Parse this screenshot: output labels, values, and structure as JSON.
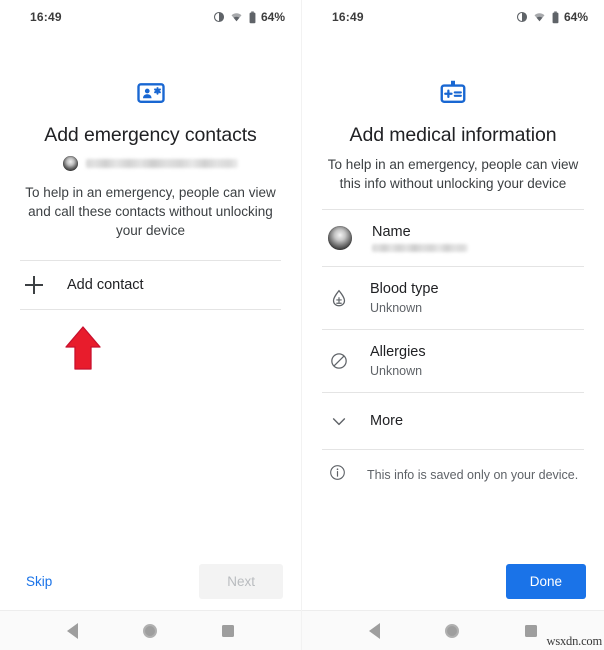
{
  "status_bar": {
    "time": "16:49",
    "battery_percent": "64%",
    "icons": [
      "dnd-icon",
      "wifi-icon",
      "battery-icon"
    ]
  },
  "left_screen": {
    "hero_icon": "emergency-contact-card-icon",
    "title": "Add emergency contacts",
    "account": {
      "avatar": "account-avatar",
      "email_redacted": true
    },
    "description": "To help in an emergency, people can view and call these contacts without unlocking your device",
    "add_contact": {
      "icon": "plus-icon",
      "label": "Add contact"
    },
    "annotation": {
      "type": "arrow-up",
      "color": "#e81c2c"
    },
    "footer": {
      "skip_label": "Skip",
      "next_label": "Next",
      "next_disabled": true
    }
  },
  "right_screen": {
    "hero_icon": "medical-id-badge-icon",
    "title": "Add medical information",
    "description": "To help in an emergency, people can view this info without unlocking your device",
    "rows": [
      {
        "icon": "account-avatar",
        "label": "Name",
        "value": "",
        "redacted": true
      },
      {
        "icon": "blood-drop-icon",
        "label": "Blood type",
        "value": "Unknown",
        "redacted": false
      },
      {
        "icon": "no-entry-icon",
        "label": "Allergies",
        "value": "Unknown",
        "redacted": false
      },
      {
        "icon": "chevron-down-icon",
        "label": "More",
        "value": "",
        "redacted": false
      }
    ],
    "info_note": {
      "icon": "info-icon",
      "text": "This info is saved only on your device."
    },
    "footer": {
      "done_label": "Done"
    }
  },
  "nav_bar": {
    "back": "back-triangle-icon",
    "home": "home-circle-icon",
    "recents": "recents-square-icon"
  },
  "watermark": "wsxdn.com",
  "colors": {
    "accent_blue": "#1a73e8",
    "annotation_red": "#e81c2c",
    "text_primary": "#202124",
    "text_secondary": "#5f6368"
  }
}
